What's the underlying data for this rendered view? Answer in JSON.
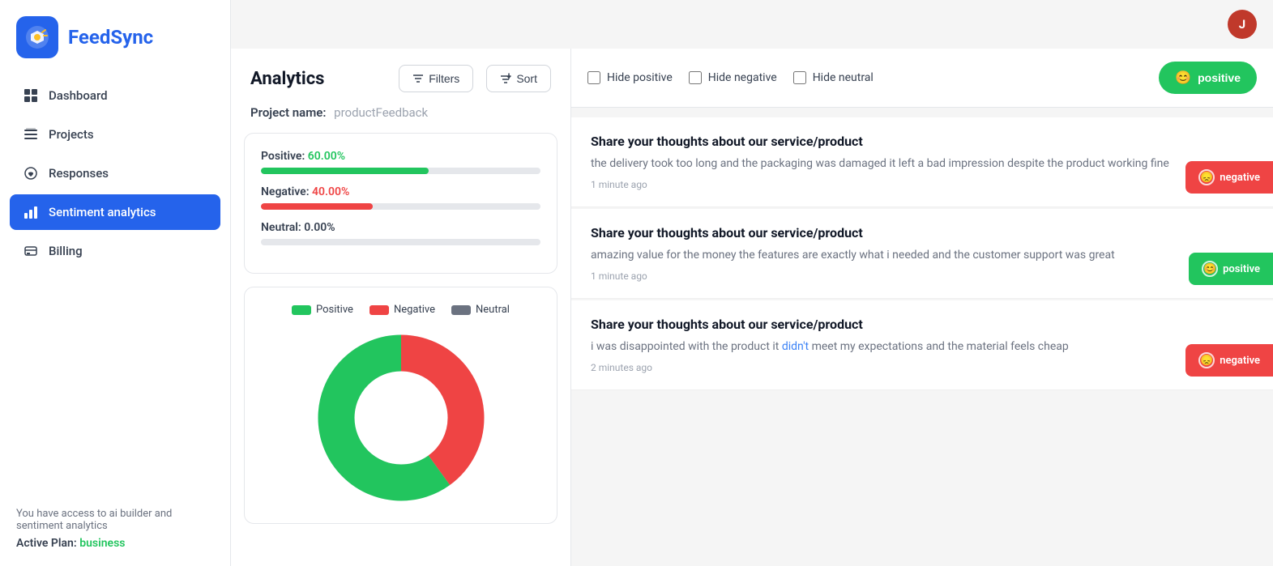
{
  "app": {
    "name": "FeedSync"
  },
  "user": {
    "initial": "J"
  },
  "sidebar": {
    "items": [
      {
        "id": "dashboard",
        "label": "Dashboard",
        "icon": "⊞",
        "active": false
      },
      {
        "id": "projects",
        "label": "Projects",
        "icon": "▤",
        "active": false
      },
      {
        "id": "responses",
        "label": "Responses",
        "icon": "◯",
        "active": false
      },
      {
        "id": "sentiment",
        "label": "Sentiment analytics",
        "icon": "📊",
        "active": true
      },
      {
        "id": "billing",
        "label": "Billing",
        "icon": "🪪",
        "active": false
      }
    ],
    "footer_text": "You have access to ai builder and sentiment analytics",
    "active_plan_label": "Active Plan:",
    "active_plan_value": "business"
  },
  "analytics": {
    "title": "Analytics",
    "filter_label": "Filters",
    "sort_label": "Sort",
    "project_label": "Project name:",
    "project_value": "productFeedback",
    "stats": {
      "positive_label": "Positive:",
      "positive_value": "60.00%",
      "positive_percent": 60,
      "negative_label": "Negative:",
      "negative_value": "40.00%",
      "negative_percent": 40,
      "neutral_label": "Neutral:",
      "neutral_value": "0.00%",
      "neutral_percent": 0
    },
    "chart": {
      "legend": [
        {
          "color": "green",
          "label": "Positive"
        },
        {
          "color": "red",
          "label": "Negative"
        },
        {
          "color": "gray",
          "label": "Neutral"
        }
      ]
    }
  },
  "filters": {
    "hide_positive": "Hide positive",
    "hide_negative": "Hide negative",
    "hide_neutral": "Hide neutral",
    "positive_btn": "positive"
  },
  "responses": [
    {
      "id": 1,
      "title": "Share your thoughts about our service/product",
      "text": "the delivery took too long and the packaging was damaged it left a bad impression despite the product working fine",
      "time": "1 minute ago",
      "sentiment": "negative",
      "badge_label": "negative"
    },
    {
      "id": 2,
      "title": "Share your thoughts about our service/product",
      "text": "amazing value for the money the features are exactly what i needed and the customer support was great",
      "time": "1 minute ago",
      "sentiment": "positive",
      "badge_label": "positive"
    },
    {
      "id": 3,
      "title": "Share your thoughts about our service/product",
      "text_parts": [
        {
          "text": "i was disappointed with the product it ",
          "type": "normal"
        },
        {
          "text": "didn't",
          "type": "red"
        },
        {
          "text": " meet my expectations and the material feels cheap",
          "type": "normal"
        }
      ],
      "time": "2 minutes ago",
      "sentiment": "negative",
      "badge_label": "negative"
    }
  ]
}
